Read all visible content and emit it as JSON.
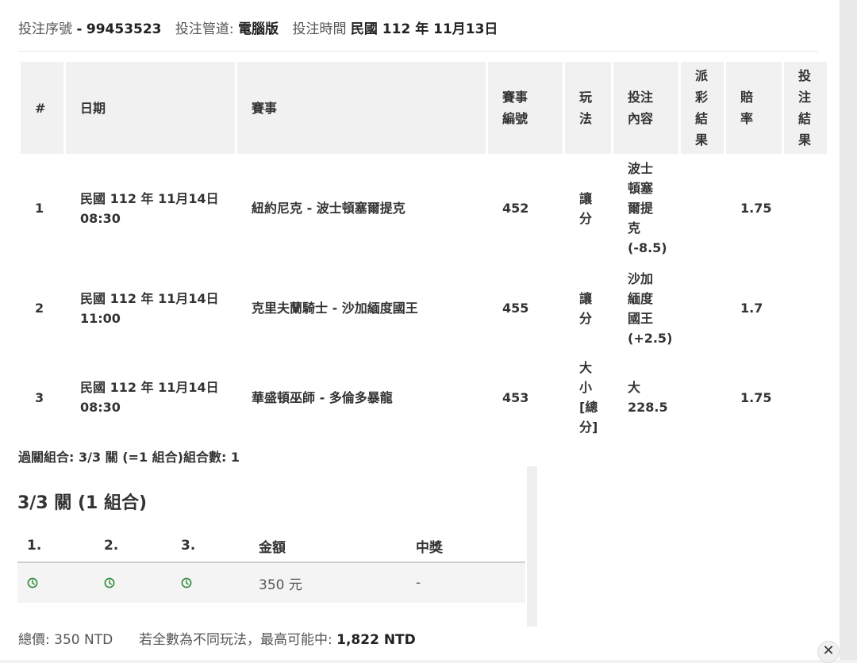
{
  "header": {
    "serial_label": "投注序號",
    "serial_sep": "-",
    "serial_value": "99453523",
    "channel_label": "投注管道:",
    "channel_value": "電腦版",
    "time_label": "投注時間",
    "time_value": "民國 112 年 11月13日"
  },
  "table": {
    "headers": [
      "#",
      "日期",
      "賽事",
      "賽事編號",
      "玩法",
      "投注內容",
      "派彩結果",
      "賠率",
      "投注結果"
    ],
    "rows": [
      {
        "no": "1",
        "date_line1": "民國 112 年 11月14日",
        "date_line2": "08:30",
        "event": "紐約尼克 - 波士頓塞爾提克",
        "event_id": "452",
        "play": "讓分",
        "content_text": "波士頓塞爾提克",
        "content_line": "(-8.5)",
        "result": "",
        "odds": "1.75",
        "outcome": ""
      },
      {
        "no": "2",
        "date_line1": "民國 112 年 11月14日",
        "date_line2": "11:00",
        "event": "克里夫蘭騎士 - 沙加緬度國王",
        "event_id": "455",
        "play": "讓分",
        "content_text": "沙加緬度國王",
        "content_line": "(+2.5)",
        "result": "",
        "odds": "1.7",
        "outcome": ""
      },
      {
        "no": "3",
        "date_line1": "民國 112 年 11月14日",
        "date_line2": "08:30",
        "event": "華盛頓巫師 - 多倫多暴龍",
        "event_id": "453",
        "play": "大小[總分]",
        "content_text": "大",
        "content_line": "228.5",
        "result": "",
        "odds": "1.75",
        "outcome": ""
      }
    ]
  },
  "parlay": {
    "summary": "過關組合: 3/3 關 (=1 組合)組合數: 1"
  },
  "combo": {
    "title": "3/3 關 (1 組合)",
    "headers": [
      "1.",
      "2.",
      "3.",
      "金額",
      "中獎"
    ],
    "row": {
      "status_icon": "clock-icon",
      "amount": "350 元",
      "win": "-"
    },
    "icon_color": "#2e8b3a"
  },
  "footer": {
    "total_label": "總價:",
    "total_value": "350 NTD",
    "max_label": "若全數為不同玩法，最高可能中:",
    "max_value": "1,822 NTD"
  },
  "close": {
    "label": "✕"
  }
}
